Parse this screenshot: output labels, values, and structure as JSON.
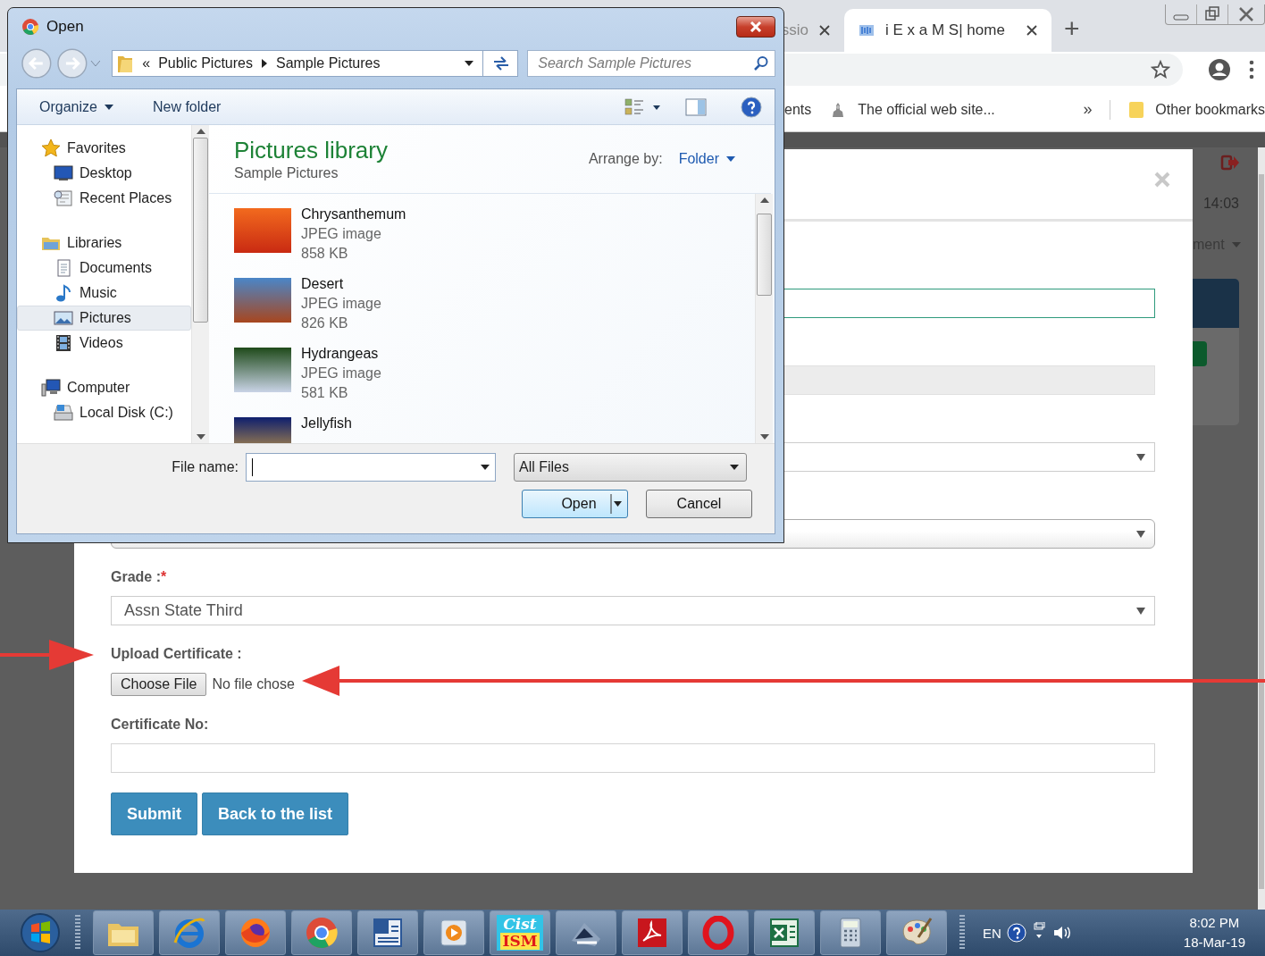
{
  "browser": {
    "tabs": [
      {
        "title": "ssio",
        "selected": false
      },
      {
        "title": "i E x a M S| home",
        "selected": true
      }
    ],
    "new_tab": "+",
    "bookmarks": [
      {
        "kind": "text",
        "label": "ents"
      },
      {
        "kind": "site",
        "label": "The official web site..."
      }
    ],
    "overflow": "»",
    "other_bookmarks": "Other bookmarks"
  },
  "page": {
    "clock": "14:03",
    "menu": "ment",
    "modal": {
      "fields": [
        {
          "kind": "text",
          "focused": true,
          "disabled": false
        },
        {
          "kind": "text",
          "focused": false,
          "disabled": true
        },
        {
          "kind": "select",
          "flat": true
        },
        {
          "kind": "select",
          "flat": false
        },
        {
          "kind": "select",
          "flat": true,
          "label": "Grade :",
          "required_mark": "*",
          "value": "Assn State Third"
        },
        {
          "kind": "file",
          "label": "Upload Certificate :",
          "button": "Choose File",
          "status": "No file chose"
        },
        {
          "kind": "text",
          "focused": false,
          "disabled": false,
          "label": "Certificate No:"
        }
      ],
      "buttons": [
        "Submit",
        "Back to the list"
      ]
    }
  },
  "dialog": {
    "title": "Open",
    "breadcrumb": {
      "prefix": "«",
      "parts": [
        "Public Pictures",
        "Sample Pictures"
      ]
    },
    "search_placeholder": "Search Sample Pictures",
    "toolbar": {
      "organize": "Organize",
      "new_folder": "New folder"
    },
    "nav": [
      {
        "label": "Favorites",
        "kind": "favorites",
        "selected": false,
        "children": [
          {
            "label": "Desktop",
            "kind": "desktop",
            "selected": false
          },
          {
            "label": "Recent Places",
            "kind": "recent",
            "selected": false
          }
        ]
      },
      {
        "label": "Libraries",
        "kind": "libraries",
        "selected": false,
        "children": [
          {
            "label": "Documents",
            "kind": "documents",
            "selected": false
          },
          {
            "label": "Music",
            "kind": "music",
            "selected": false
          },
          {
            "label": "Pictures",
            "kind": "pictures",
            "selected": true
          },
          {
            "label": "Videos",
            "kind": "videos",
            "selected": false
          }
        ]
      },
      {
        "label": "Computer",
        "kind": "computer",
        "selected": false,
        "children": [
          {
            "label": "Local Disk (C:)",
            "kind": "disk",
            "selected": false
          }
        ]
      }
    ],
    "library": {
      "title": "Pictures library",
      "subtitle": "Sample Pictures",
      "arrange_label": "Arrange by:",
      "arrange_value": "Folder"
    },
    "files": [
      {
        "kind": "flower",
        "name": "Chrysanthemum",
        "type": "JPEG image",
        "size": "858 KB"
      },
      {
        "kind": "desert",
        "name": "Desert",
        "type": "JPEG image",
        "size": "826 KB"
      },
      {
        "kind": "hydrangea",
        "name": "Hydrangeas",
        "type": "JPEG image",
        "size": "581 KB"
      },
      {
        "kind": "jellyfish",
        "name": "Jellyfish"
      }
    ],
    "file_name_label": "File name:",
    "filter": "All Files",
    "open": "Open",
    "cancel": "Cancel"
  },
  "taskbar": {
    "apps": [
      {
        "kind": "folder"
      },
      {
        "kind": "ie"
      },
      {
        "kind": "firefox"
      },
      {
        "kind": "chrome"
      },
      {
        "kind": "word"
      },
      {
        "kind": "media"
      },
      {
        "kind": "cist",
        "lines": [
          "Cist",
          "ISM"
        ]
      },
      {
        "kind": "fax"
      },
      {
        "kind": "pdf"
      },
      {
        "kind": "opera"
      },
      {
        "kind": "excel"
      },
      {
        "kind": "calculator"
      },
      {
        "kind": "paint"
      }
    ],
    "language": "EN",
    "time": "8:02 PM",
    "date": "18-Mar-19"
  }
}
